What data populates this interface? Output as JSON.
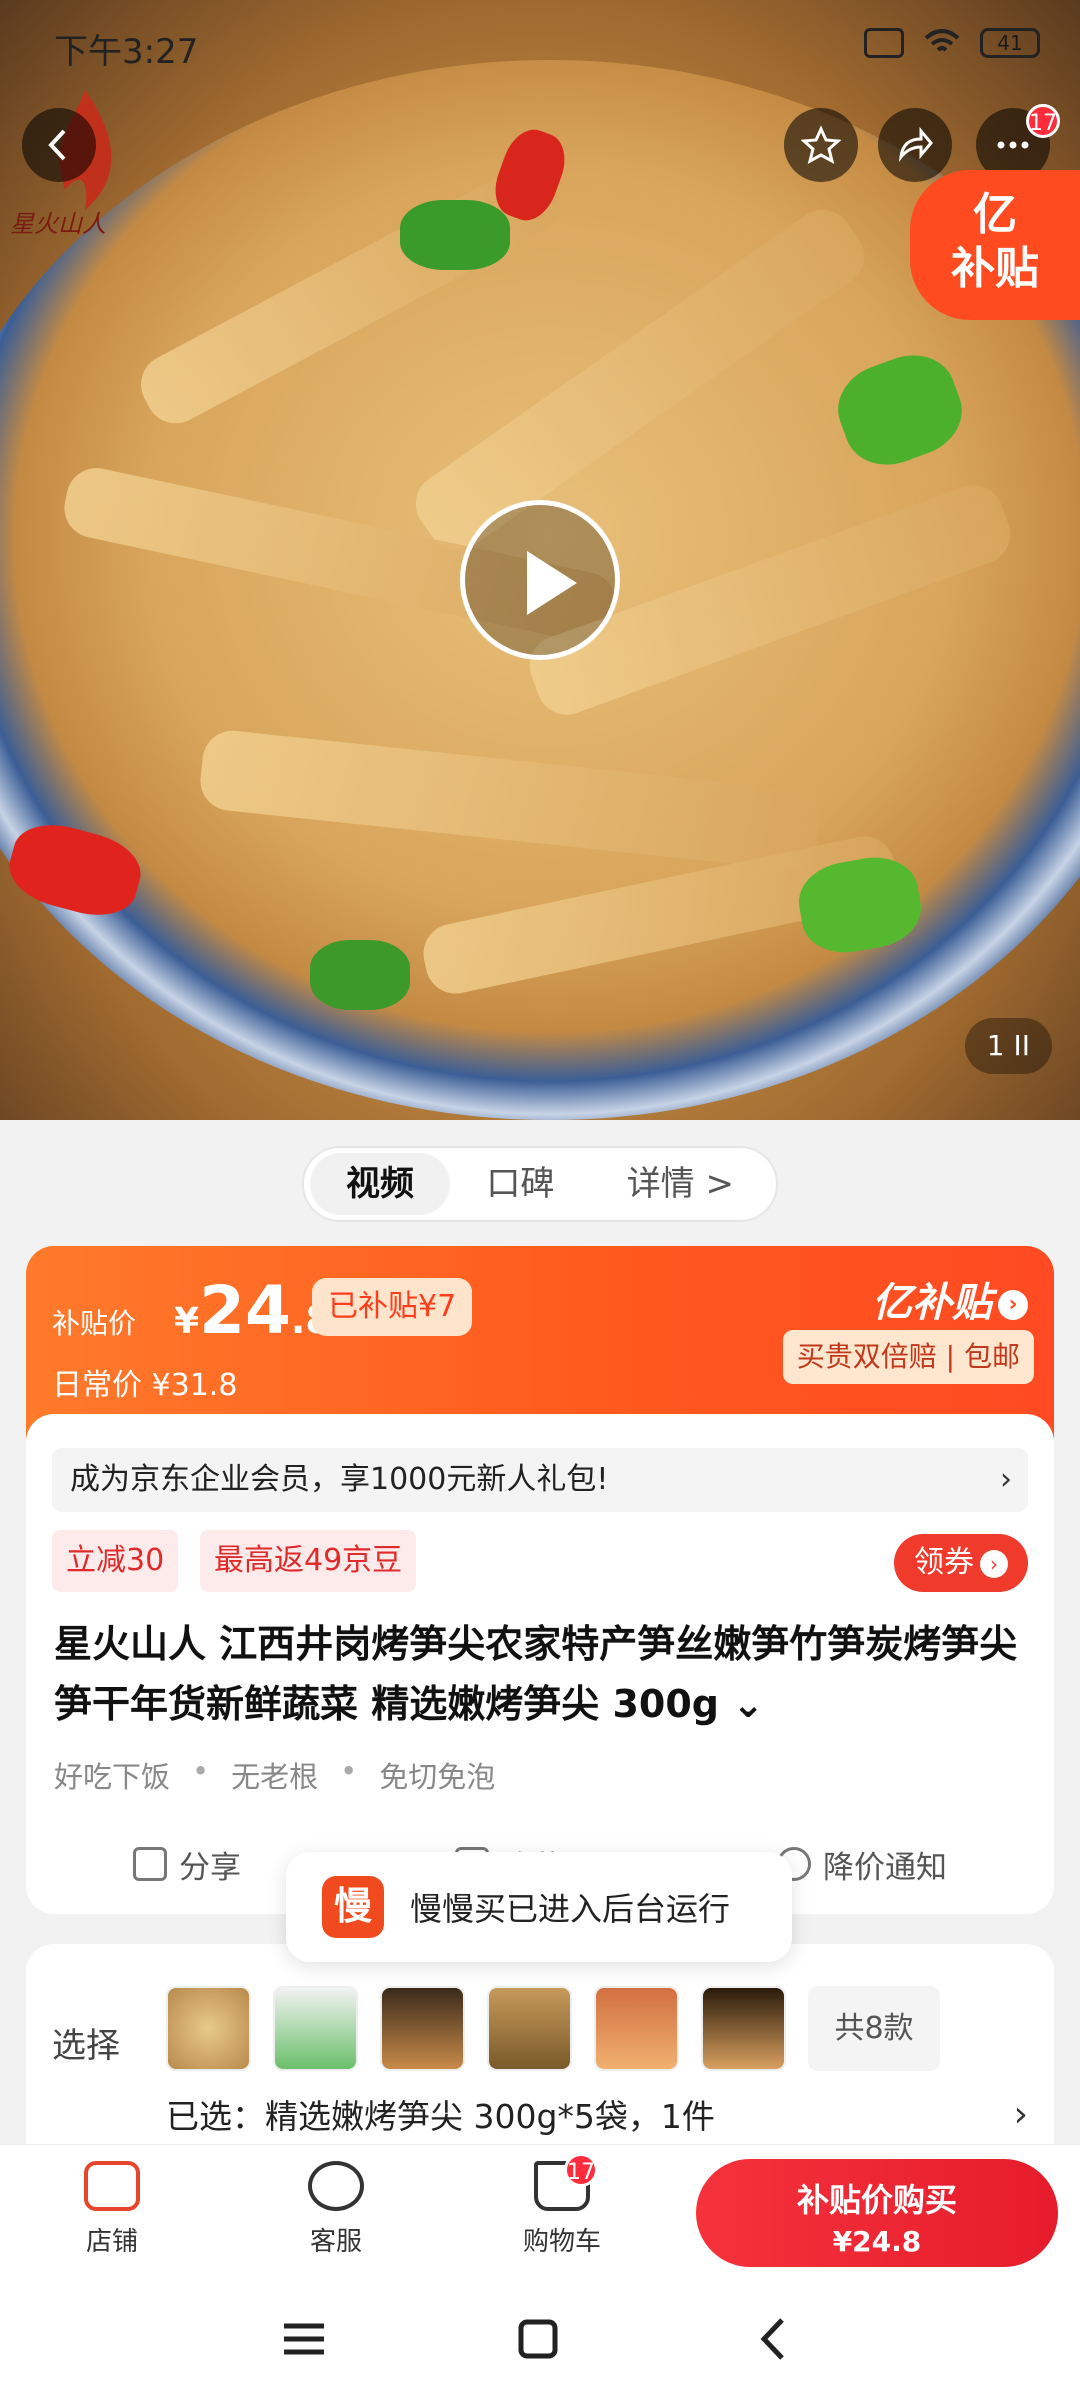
{
  "status_bar": {
    "time": "下午3:27",
    "battery": "41"
  },
  "hero": {
    "brand_logo_text": "星火山人",
    "yi_badge_line1": "亿",
    "yi_badge_line2": "补贴",
    "cart_badge": "17",
    "pager": "1 ⅠⅠ"
  },
  "tabs": [
    {
      "label": "视频"
    },
    {
      "label": "口碑"
    },
    {
      "label": "详情 >"
    }
  ],
  "price": {
    "label": "补贴价",
    "yen": "¥",
    "integer": "24",
    "decimal": ".8",
    "subsidy_badge": "已补贴¥7",
    "daily": "日常价 ¥31.8",
    "yi_logo": "亿补贴",
    "perks": "买贵双倍赔 | 包邮"
  },
  "info": {
    "promo": "成为京东企业会员，享1000元新人礼包!",
    "tag1": "立减30",
    "tag2": "最高返49京豆",
    "coupon": "领券",
    "title": "星火山人 江西井岗烤笋尖农家特产笋丝嫩笋竹笋炭烤笋尖笋干年货新鲜蔬菜 精选嫩烤笋尖  300g",
    "features": [
      "好吃下饭",
      "无老根",
      "免切免泡"
    ],
    "actions": {
      "share": "分享",
      "favorite": "收藏",
      "price_alert": "降价通知"
    }
  },
  "toast": {
    "icon_text": "慢",
    "text": "慢慢买已进入后台运行"
  },
  "select": {
    "label": "选择",
    "total": "共8款",
    "chosen": "已选：精选嫩烤笋尖  300g*5袋，1件"
  },
  "bottom_bar": {
    "store": "店铺",
    "service": "客服",
    "cart": "购物车",
    "cart_badge": "17",
    "buy_line1": "补贴价购买",
    "buy_line2": "¥24.8"
  },
  "colors": {
    "accent": "#ff4a22",
    "buy": "#e61c2b"
  }
}
